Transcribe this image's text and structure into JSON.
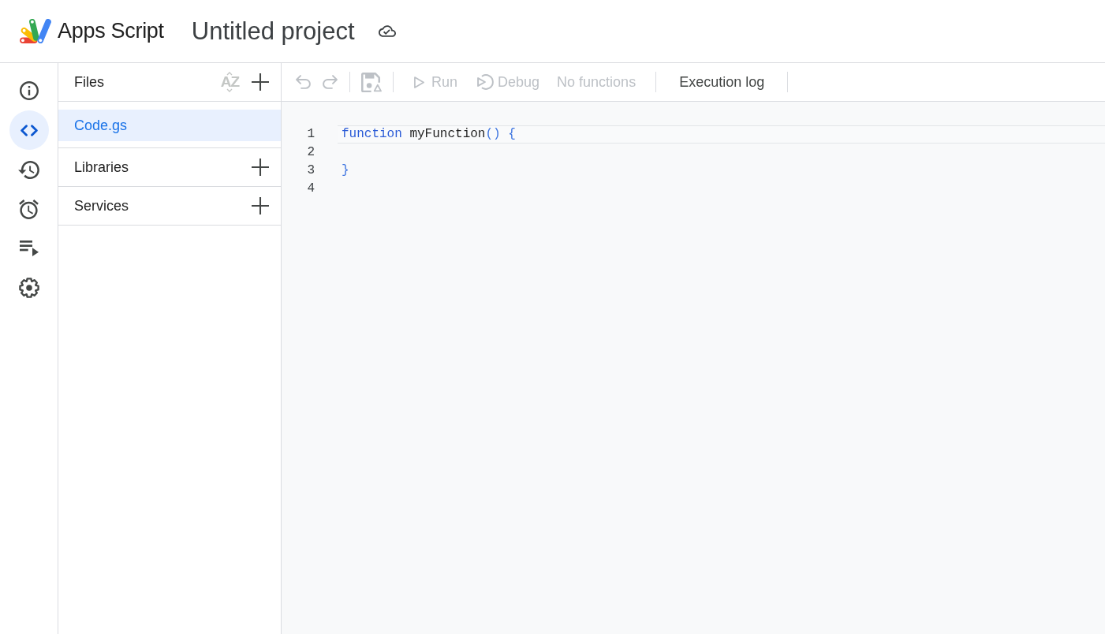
{
  "header": {
    "product": "Apps Script",
    "project_title": "Untitled project"
  },
  "nav_rail": {
    "items": [
      {
        "kind": "info",
        "selected": false
      },
      {
        "kind": "code",
        "selected": true
      },
      {
        "kind": "history",
        "selected": false
      },
      {
        "kind": "triggers",
        "selected": false
      },
      {
        "kind": "executions",
        "selected": false
      },
      {
        "kind": "settings",
        "selected": false
      }
    ]
  },
  "files_panel": {
    "title": "Files",
    "sort": {
      "label": "AZ",
      "disabled": true
    },
    "files": [
      {
        "name": "Code.gs",
        "selected": true
      }
    ],
    "sections": [
      {
        "title": "Libraries"
      },
      {
        "title": "Services"
      }
    ]
  },
  "toolbar": {
    "undo": {
      "disabled": true
    },
    "redo": {
      "disabled": true
    },
    "save": {
      "disabled": true
    },
    "run": {
      "label": "Run",
      "disabled": true
    },
    "debug": {
      "label": "Debug",
      "disabled": true
    },
    "function_select": {
      "value": "No functions",
      "disabled": true
    },
    "execution_log": {
      "label": "Execution log",
      "disabled": false
    }
  },
  "editor": {
    "lines": [
      {
        "number": "1",
        "current": true,
        "tokens": [
          {
            "kind": "keyword",
            "text": "function"
          },
          {
            "kind": "name",
            "text": " myFunction"
          },
          {
            "kind": "punct",
            "text": "()"
          },
          {
            "kind": "punct",
            "text": " {"
          }
        ]
      },
      {
        "number": "2",
        "current": false
      },
      {
        "number": "3",
        "current": false,
        "tokens": [
          {
            "kind": "punct",
            "text": "}"
          }
        ]
      },
      {
        "number": "4",
        "current": false
      }
    ]
  }
}
